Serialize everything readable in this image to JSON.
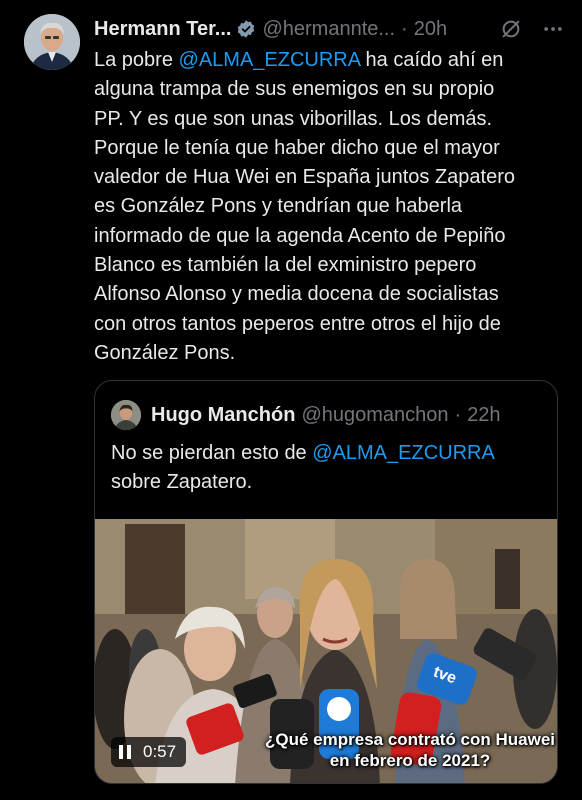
{
  "tweet": {
    "author_name": "Hermann Ter...",
    "author_handle": "@hermannte...",
    "separator": "·",
    "timestamp": "20h",
    "text_mention": "@ALMA_EZCURRA",
    "text_before": "La pobre ",
    "text_after": " ha caído ahí en\nalguna trampa de sus enemigos en su propio\nPP. Y es que son unas viborillas. Los demás.\nPorque le tenía que haber dicho que el mayor\nvaledor de Hua Wei en España juntos Zapatero\nes González Pons y tendrían que haberla\ninformado de que la agenda Acento de Pepiño\nBlanco es también la del exministro pepero\nAlfonso Alonso y media docena de socialistas\ncon otros tantos peperos entre otros el hijo de\nGonzález Pons."
  },
  "quoted_tweet": {
    "author_name": "Hugo Manchón",
    "author_handle": "@hugomanchon",
    "separator": "·",
    "timestamp": "22h",
    "text_before": "No se pierdan esto de ",
    "text_mention": "@ALMA_EZCURRA",
    "text_after": "\nsobre Zapatero."
  },
  "video": {
    "caption": "¿Qué empresa contrató con Huawei en febrero de 2021?",
    "duration": "0:57",
    "mic_label": "tve"
  },
  "colors": {
    "accent": "#1d9bf0",
    "text": "#e7e9ea",
    "muted": "#71767b",
    "border": "#2f3336"
  }
}
